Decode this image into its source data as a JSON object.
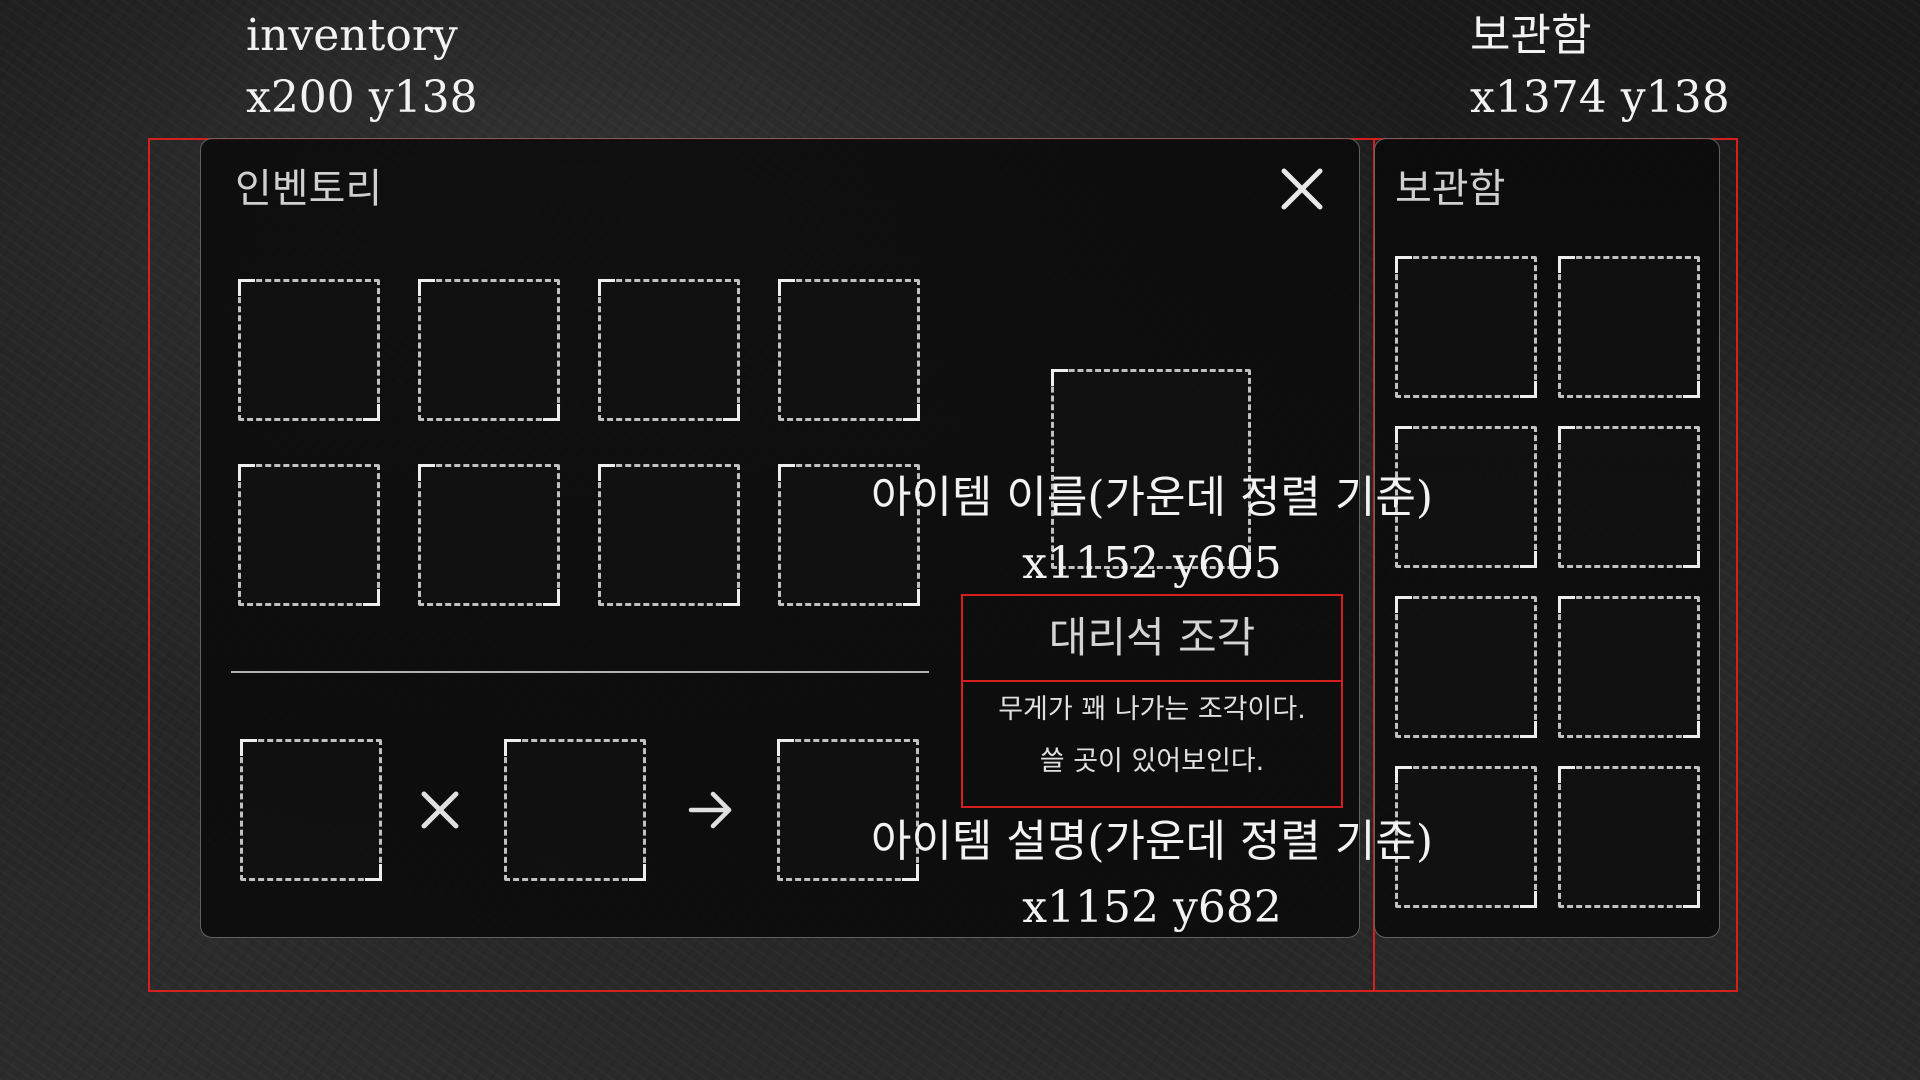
{
  "annotations": {
    "inventory_label": "inventory",
    "inventory_coords": "x200 y138",
    "storage_label": "보관함",
    "storage_coords": "x1374 y138",
    "item_name_label": "아이템 이름(가운데 정렬 기준)",
    "item_name_coords": "x1152 y605",
    "item_desc_label": "아이템 설명(가운데 정렬 기준)",
    "item_desc_coords": "x1152 y682"
  },
  "inventory": {
    "title": "인벤토리",
    "close_icon": "close-icon",
    "slot_count": 8
  },
  "crafting": {
    "operator_icon": "multiply-icon",
    "result_icon": "arrow-right-icon"
  },
  "item_detail": {
    "name": "대리석 조각",
    "description_line1": "무게가 꽤 나가는 조각이다.",
    "description_line2": "쓸 곳이 있어보인다."
  },
  "storage": {
    "title": "보관함",
    "slot_count": 8
  },
  "colors": {
    "annotation_box": "#d62020",
    "slot_border": "#e1e1e1",
    "panel_background": "#080808"
  }
}
